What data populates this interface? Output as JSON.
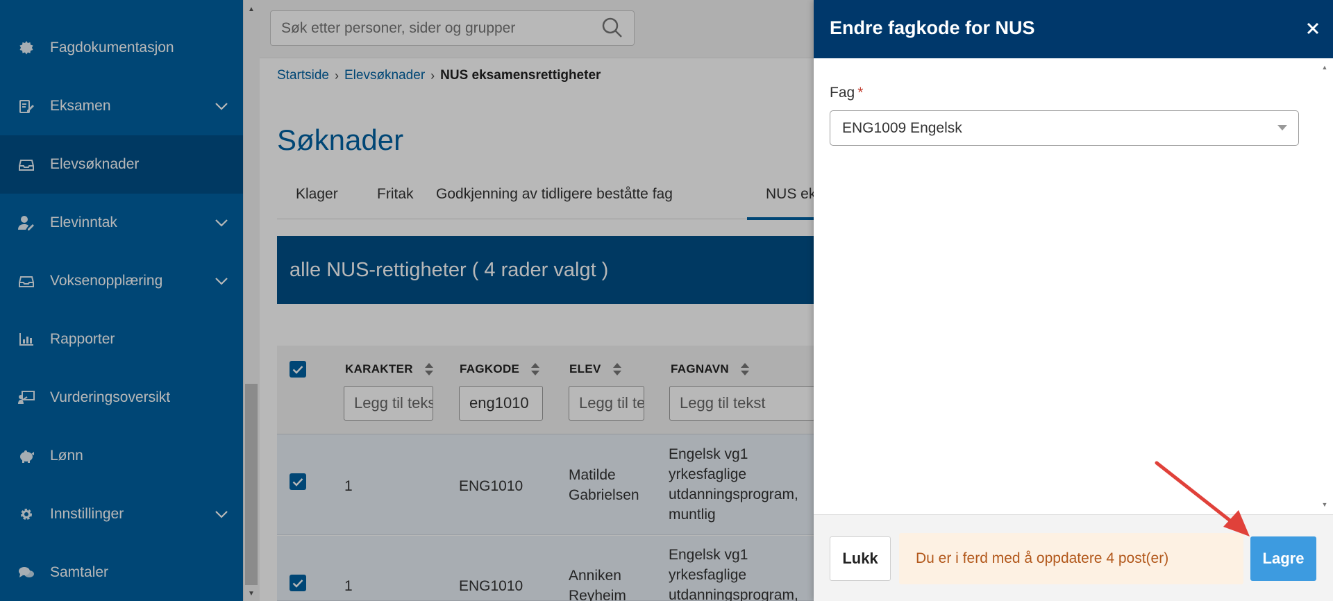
{
  "sidebar": {
    "items": [
      {
        "label": "Fagdokumentasjon",
        "icon": "cog-badge-icon",
        "has_chevron": false
      },
      {
        "label": "Eksamen",
        "icon": "exam-edit-icon",
        "has_chevron": true
      },
      {
        "label": "Elevsøknader",
        "icon": "inbox-icon",
        "has_chevron": false,
        "active": true
      },
      {
        "label": "Elevinntak",
        "icon": "user-edit-icon",
        "has_chevron": true
      },
      {
        "label": "Voksenopplæring",
        "icon": "inbox-icon",
        "has_chevron": true
      },
      {
        "label": "Rapporter",
        "icon": "bar-chart-icon",
        "has_chevron": false
      },
      {
        "label": "Vurderingsoversikt",
        "icon": "presentation-icon",
        "has_chevron": false
      },
      {
        "label": "Lønn",
        "icon": "piggy-bank-icon",
        "has_chevron": false
      },
      {
        "label": "Innstillinger",
        "icon": "gear-icon",
        "has_chevron": true
      },
      {
        "label": "Samtaler",
        "icon": "chat-bubbles-icon",
        "has_chevron": false
      }
    ]
  },
  "search": {
    "placeholder": "Søk etter personer, sider og grupper"
  },
  "breadcrumb": {
    "home": "Startside",
    "parent": "Elevsøknader",
    "current": "NUS eksamensrettigheter"
  },
  "page": {
    "title": "Søknader"
  },
  "tabs": [
    "Klager",
    "Fritak",
    "Godkjenning av tidligere beståtte fag",
    "NUS eksa"
  ],
  "banner": {
    "text": "alle NUS-rettigheter ( 4 rader valgt )"
  },
  "table": {
    "headers": [
      "KARAKTER",
      "FAGKODE",
      "ELEV",
      "FAGNAVN"
    ],
    "filters": {
      "karakter_placeholder": "Legg til tekst",
      "fagkode_value": "eng1010",
      "elev_placeholder": "Legg til tekst",
      "fagnavn_placeholder": "Legg til tekst"
    },
    "rows": [
      {
        "karakter": "1",
        "fagkode": "ENG1010",
        "elev_line1": "Matilde",
        "elev_line2": "Gabrielsen",
        "fagnavn_lines": [
          "Engelsk vg1",
          "yrkesfaglige",
          "utdanningsprogram,",
          "muntlig"
        ]
      },
      {
        "karakter": "1",
        "fagkode": "ENG1010",
        "elev_line1": "Anniken",
        "elev_line2": "Reyheim",
        "fagnavn_lines": [
          "Engelsk vg1",
          "yrkesfaglige",
          "utdanningsprogram,"
        ]
      }
    ]
  },
  "drawer": {
    "title": "Endre fagkode for NUS",
    "field_label": "Fag",
    "required_mark": "*",
    "selected_value": "ENG1009 Engelsk",
    "close_label": "Lukk",
    "notice": "Du er i ferd med å oppdatere 4 post(er)",
    "save_label": "Lagre"
  },
  "colors": {
    "sidebar": "#0062a3",
    "sidebar_active": "#004f88",
    "drawer_header": "#00386b",
    "save_button": "#3d9be0",
    "notice_bg": "#fdf1e3",
    "notice_text": "#b2581b",
    "annotation_arrow": "#e0413a"
  }
}
